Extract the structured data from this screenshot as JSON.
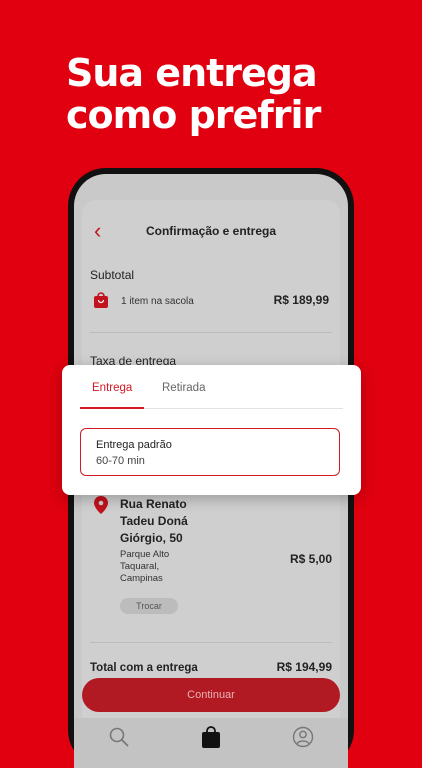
{
  "headline": {
    "line1": "Sua entrega",
    "line2": "como prefrir"
  },
  "screen": {
    "title": "Confirmação e entrega",
    "subtotal_label": "Subtotal",
    "bag_text": "1 item na sacola",
    "subtotal_price": "R$ 189,99",
    "fee_label": "Taxa de entrega",
    "address": {
      "line1": "Rua Renato",
      "line2": "Tadeu Doná",
      "line3": "Giórgio, 50"
    },
    "area": {
      "line1": "Parque Alto",
      "line2": "Taquaral,",
      "line3": "Campinas"
    },
    "fee_price": "R$ 5,00",
    "change_label": "Trocar",
    "total_label": "Total com a entrega",
    "total_price": "R$ 194,99",
    "continue_label": "Continuar"
  },
  "modal": {
    "tabs": [
      {
        "label": "Entrega",
        "active": true
      },
      {
        "label": "Retirada",
        "active": false
      }
    ],
    "option": {
      "title": "Entrega padrão",
      "time": "60-70 min"
    }
  },
  "tabbar": {
    "items": [
      "search-icon",
      "bag-icon",
      "profile-icon"
    ]
  },
  "colors": {
    "brand_red": "#e0000f",
    "accent_red": "#d11a24",
    "button_red": "#b11a23"
  }
}
